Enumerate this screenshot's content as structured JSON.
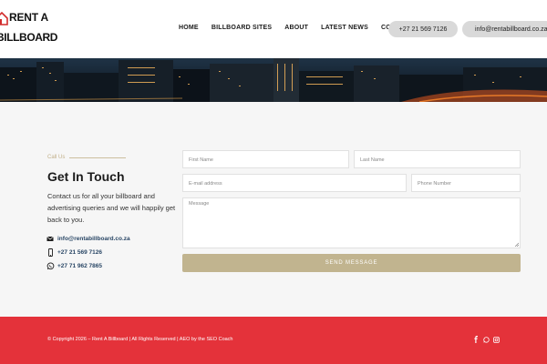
{
  "brand": {
    "line1": "RENT A",
    "line2": "BILLBOARD"
  },
  "nav": {
    "items": [
      "HOME",
      "BILLBOARD SITES",
      "ABOUT",
      "LATEST NEWS",
      "CONTACT"
    ],
    "phone_pill": "+27 21 569 7126",
    "email_pill": "info@rentabillboard.co.za"
  },
  "contact": {
    "eyebrow": "Call Us",
    "title": "Get In Touch",
    "description": "Contact us for all your billboard and advertising queries and we will happily get back to you.",
    "email": "info@rentabillboard.co.za",
    "phone": "+27 21 569 7126",
    "whatsapp": "+27 71 962 7865"
  },
  "form": {
    "first_name_placeholder": "First Name",
    "last_name_placeholder": "Last Name",
    "email_placeholder": "E-mail address",
    "phone_placeholder": "Phone Number",
    "message_placeholder": "Message",
    "submit_label": "SEND MESSAGE"
  },
  "footer": {
    "copyright": "© Copyright 2026 – Rent A Billboard | All Rights Reserved | AEO by the SEO Coach"
  },
  "colors": {
    "accent_gold": "#c1b48f",
    "footer_red": "#e4323a",
    "link_blue": "#2a4766"
  }
}
